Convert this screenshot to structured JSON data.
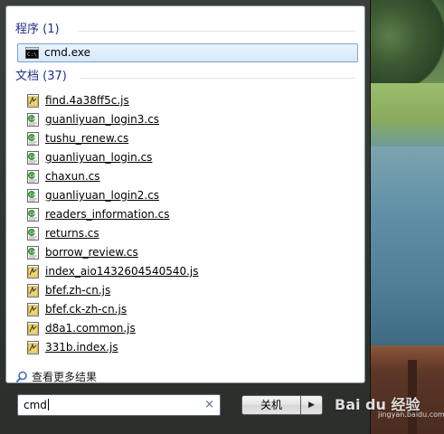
{
  "sections": {
    "programs": {
      "header": "程序 (1)"
    },
    "documents": {
      "header": "文档 (37)"
    }
  },
  "programs": [
    {
      "label": "cmd.exe",
      "icon": "cmd-icon"
    }
  ],
  "documents": [
    {
      "label": "find.4a38ff5c.js",
      "icon": "js-file-icon"
    },
    {
      "label": "guanliyuan_login3.cs",
      "icon": "cs-file-icon"
    },
    {
      "label": "tushu_renew.cs",
      "icon": "cs-file-icon"
    },
    {
      "label": "guanliyuan_login.cs",
      "icon": "cs-file-icon"
    },
    {
      "label": "chaxun.cs",
      "icon": "cs-file-icon"
    },
    {
      "label": "guanliyuan_login2.cs",
      "icon": "cs-file-icon"
    },
    {
      "label": "readers_information.cs",
      "icon": "cs-file-icon"
    },
    {
      "label": "returns.cs",
      "icon": "cs-file-icon"
    },
    {
      "label": "borrow_review.cs",
      "icon": "cs-file-icon"
    },
    {
      "label": "index_aio1432604540540.js",
      "icon": "js-file-icon"
    },
    {
      "label": "bfef.zh-cn.js",
      "icon": "js-file-icon"
    },
    {
      "label": "bfef.ck-zh-cn.js",
      "icon": "js-file-icon"
    },
    {
      "label": "d8a1.common.js",
      "icon": "js-file-icon"
    },
    {
      "label": "331b.index.js",
      "icon": "js-file-icon"
    }
  ],
  "see_more": {
    "label": "查看更多结果",
    "icon": "search-icon"
  },
  "search": {
    "value": "cmd",
    "clear_icon": "×"
  },
  "shutdown": {
    "label": "关机",
    "arrow": "▶"
  },
  "watermark": {
    "text": "Bai du 经验",
    "sub": "jingyan.baidu.com"
  },
  "colors": {
    "header_text": "#1e3287",
    "selection_border": "#7da2ce",
    "selection_fill": "#d6e8fb"
  }
}
